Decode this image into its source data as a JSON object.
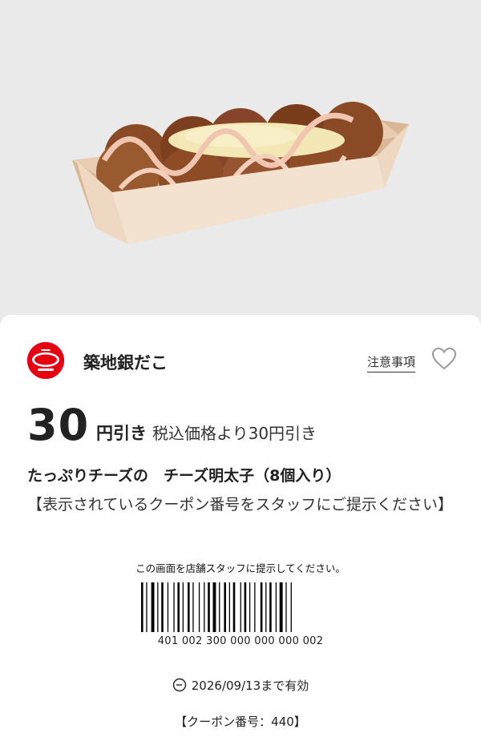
{
  "shop": {
    "name": "築地銀だこ",
    "logo_icon": "gindaco-logo"
  },
  "links": {
    "notes_label": "注意事項"
  },
  "icons": {
    "favorite": "heart-outline-icon",
    "validity": "clock-icon"
  },
  "price": {
    "amount": "30",
    "unit": "円引き",
    "description": "税込価格より30円引き"
  },
  "product": {
    "name": "たっぷりチーズの　チーズ明太子（8個入り）"
  },
  "instruction": "【表示されているクーポン番号をスタッフにご提示ください】",
  "barcode": {
    "caption": "この画面を店舗スタッフに提示してください。",
    "number": "401 002 300 000 000 000 002"
  },
  "validity": "2026/09/13まで有効",
  "coupon_number": "【クーポン番号：440】",
  "colors": {
    "brand": "#e60012",
    "text": "#222222",
    "background": "#eaeaea"
  }
}
